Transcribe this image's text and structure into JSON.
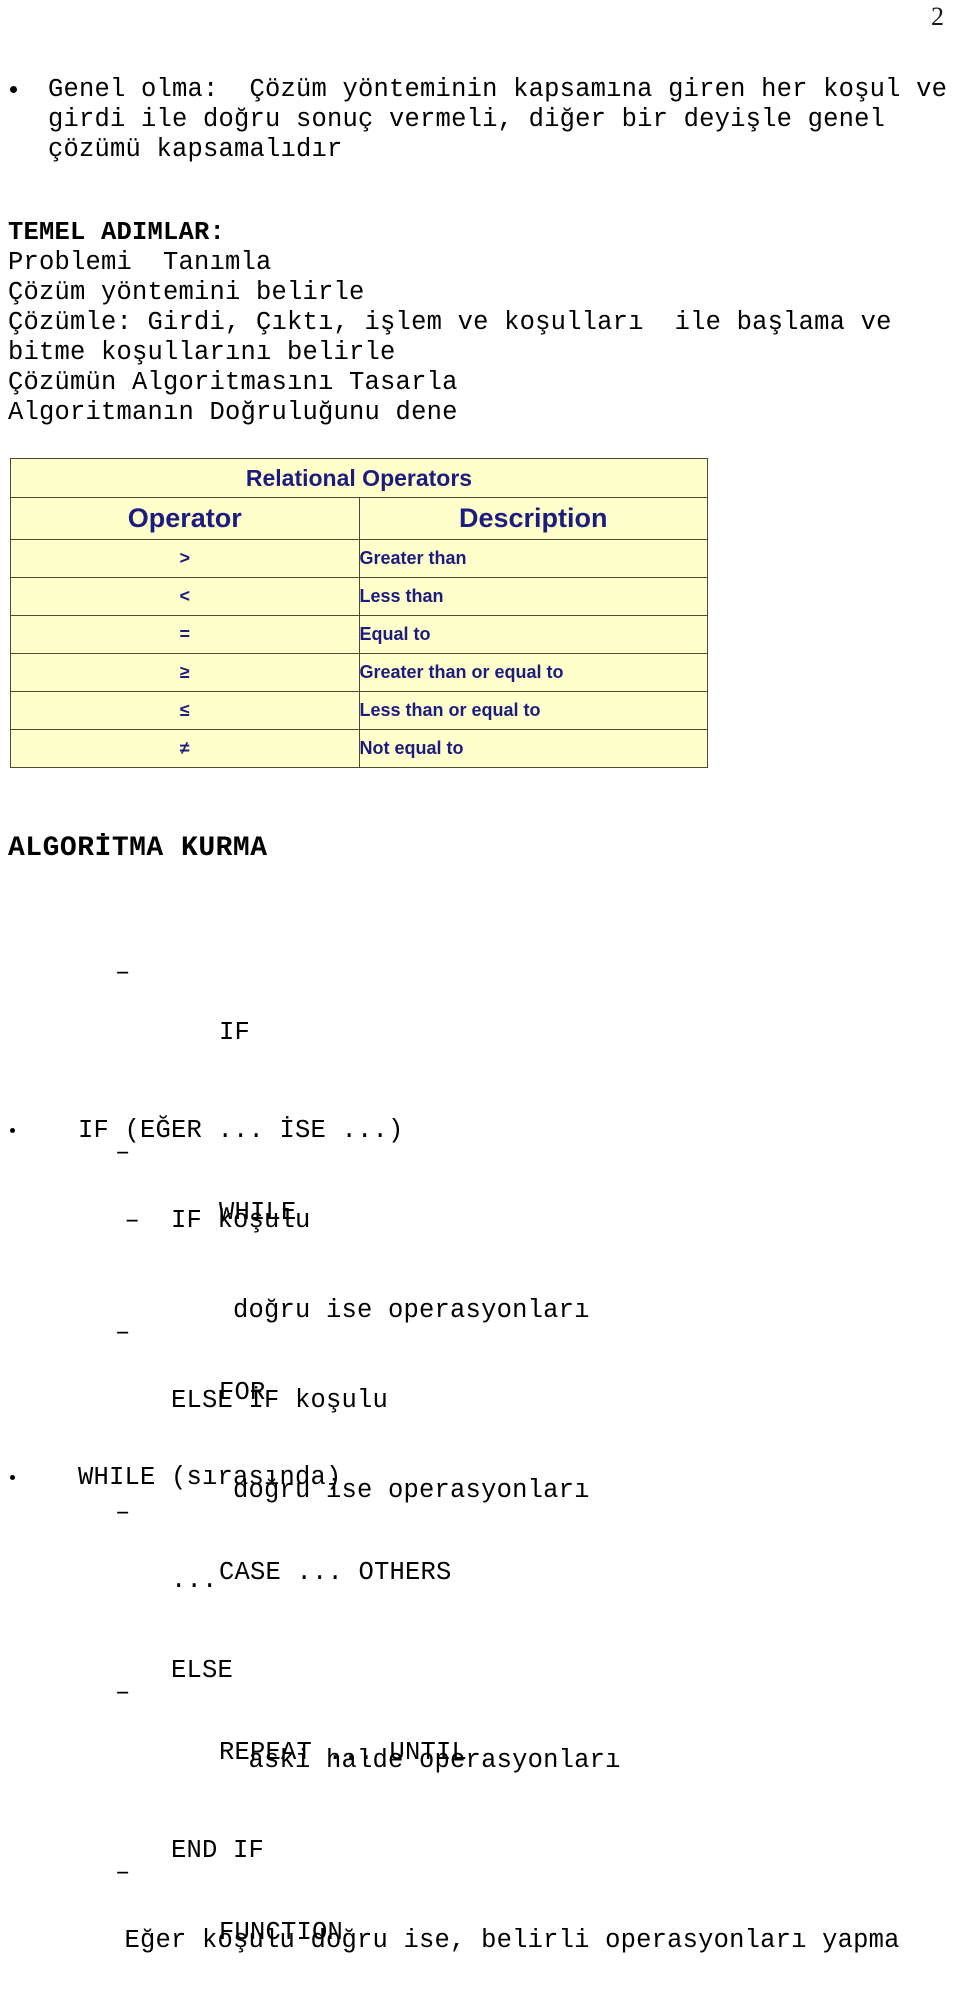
{
  "page": {
    "number": "2"
  },
  "intro": {
    "bullet_icon": "bullet-dot-icon",
    "text": "Genel olma:  Çözüm yönteminin kapsamına giren her koşul ve\ngirdi ile doğru sonuç vermeli, diğer bir deyişle genel\nçözümü kapsamalıdır"
  },
  "steps": {
    "heading": "TEMEL ADIMLAR:",
    "lines": [
      "Problemi  Tanımla",
      "Çözüm yöntemini belirle",
      "Çözümle: Girdi, Çıktı, işlem ve koşulları  ile başlama ve",
      "bitme koşullarını belirle",
      "Çözümün Algoritmasını Tasarla",
      "Algoritmanın Doğruluğunu dene"
    ]
  },
  "operators_table": {
    "title": "Relational Operators",
    "columns": [
      "Operator",
      "Description"
    ],
    "rows": [
      {
        "operator": ">",
        "description": "Greater than"
      },
      {
        "operator": "<",
        "description": "Less than"
      },
      {
        "operator": "=",
        "description": "Equal to"
      },
      {
        "operator": "≥",
        "description": "Greater than or equal to"
      },
      {
        "operator": "≤",
        "description": "Less than or equal to"
      },
      {
        "operator": "≠",
        "description": "Not equal to"
      }
    ],
    "colors": {
      "cell_background": "#FFFFCC",
      "text": "#1C1C80",
      "border": "#4A4A35"
    }
  },
  "algorithm_section": {
    "heading": "ALGORİTMA KURMA",
    "dash_mark": "–",
    "items": [
      "IF",
      "WHILE",
      "FOR",
      "CASE ... OTHERS",
      "REPEAT ... UNTIL",
      "FUNCTION"
    ]
  },
  "if_construct": {
    "bullet_icon": "bullet-dot-icon",
    "title": "IF (EĞER ... İSE ...)",
    "dash_mark": "–",
    "lines": [
      "   –  IF koşulu",
      "          doğru ise operasyonları",
      "      ELSE İF koşulu",
      "          doğru ise operasyonları",
      "      ...",
      "      ELSE",
      "           aski halde operasyonları",
      "      END IF",
      "   Eğer koşulu doğru ise, belirli operasyonları yapma"
    ]
  },
  "while_construct": {
    "bullet_icon": "bullet-dot-icon",
    "title": "WHILE (sırasında)"
  }
}
